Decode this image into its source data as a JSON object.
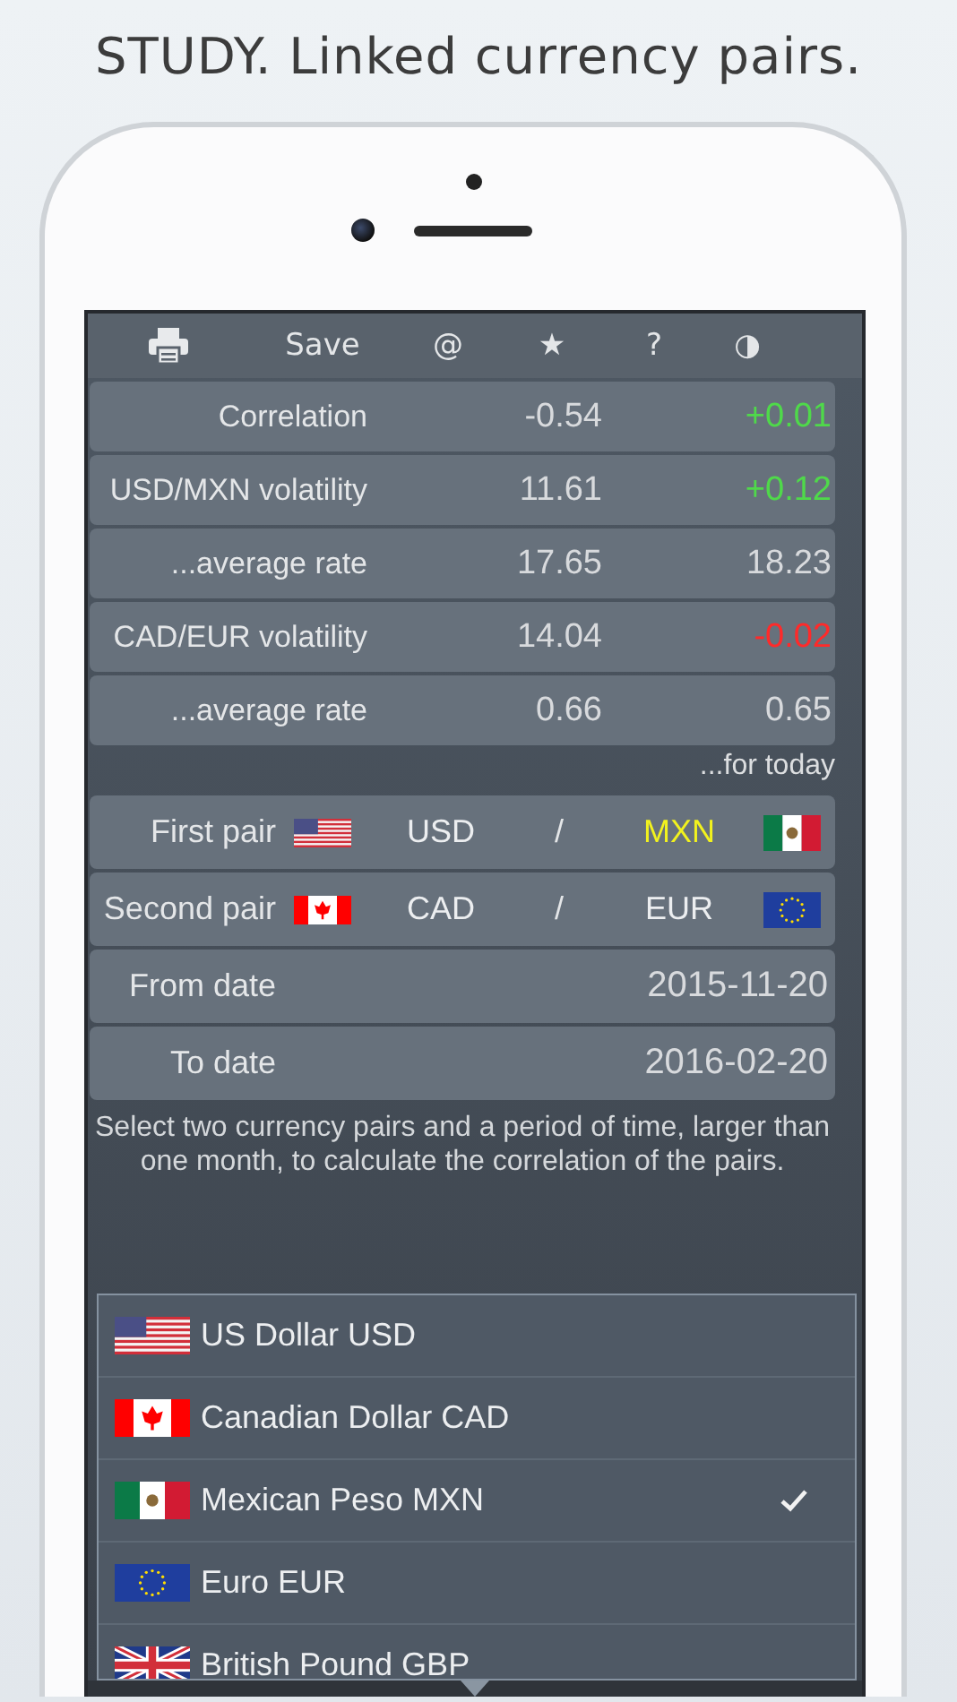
{
  "headline": "STUDY. Linked currency pairs.",
  "toolbar": {
    "items": [
      "Save",
      "@",
      "★",
      "?",
      "◑"
    ]
  },
  "stats": [
    {
      "label": "Correlation",
      "value": "-0.54",
      "change": "+0.01",
      "color": "#4fd94a"
    },
    {
      "label": "USD/MXN volatility",
      "value": "11.61",
      "change": "+0.12",
      "color": "#4fd94a"
    },
    {
      "label": "...average rate",
      "value": "17.65",
      "change": "18.23",
      "color": "#d8dadd"
    },
    {
      "label": "CAD/EUR volatility",
      "value": "14.04",
      "change": "-0.02",
      "color": "#ff2a2a"
    },
    {
      "label": "...average rate",
      "value": "0.66",
      "change": "0.65",
      "color": "#d8dadd"
    }
  ],
  "stats_note": "...for today",
  "pairs": [
    {
      "label": "First pair",
      "separator": "/",
      "base": {
        "code": "USD",
        "kind": "us",
        "selected": false
      },
      "quote": {
        "code": "MXN",
        "kind": "mx",
        "selected": true
      }
    },
    {
      "label": "Second pair",
      "separator": "/",
      "base": {
        "code": "CAD",
        "kind": "ca",
        "selected": false
      },
      "quote": {
        "code": "EUR",
        "kind": "eu",
        "selected": false
      }
    }
  ],
  "dates": [
    {
      "label": "From date",
      "value": "2015-11-20"
    },
    {
      "label": "To date",
      "value": "2016-02-20"
    }
  ],
  "description": "Select two currency pairs and a period of time, larger than one month, to calculate the correlation of the pairs.",
  "currency_list": [
    {
      "name": "US Dollar USD",
      "kind": "us",
      "selected": false
    },
    {
      "name": "Canadian Dollar CAD",
      "kind": "ca",
      "selected": false
    },
    {
      "name": "Mexican Peso MXN",
      "kind": "mx",
      "selected": true
    },
    {
      "name": "Euro EUR",
      "kind": "eu",
      "selected": false
    },
    {
      "name": "British Pound GBP",
      "kind": "gb",
      "selected": false
    }
  ]
}
